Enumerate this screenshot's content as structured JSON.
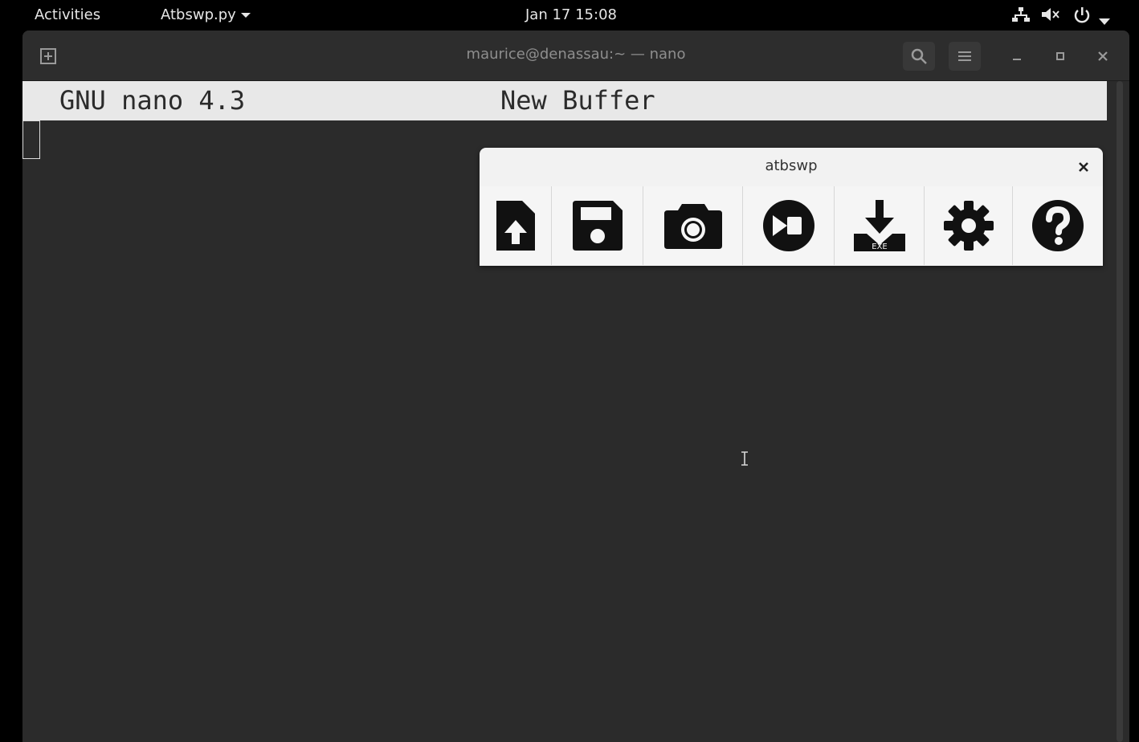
{
  "topbar": {
    "activities": "Activities",
    "app_menu": "Atbswp.py",
    "clock": "Jan 17  15:08",
    "icons": [
      "network-icon",
      "volume-muted-icon",
      "power-icon",
      "chevron-down-icon"
    ]
  },
  "terminal": {
    "title": "maurice@denassau:~ — nano",
    "header_icons": [
      "new-tab-icon",
      "search-icon",
      "hamburger-menu-icon",
      "minimize-icon",
      "maximize-icon",
      "close-icon"
    ]
  },
  "nano": {
    "version": "GNU nano 4.3",
    "buffer": "New Buffer"
  },
  "atbswp": {
    "title": "atbswp",
    "tools": [
      {
        "name": "load-file-button",
        "icon": "file-upload-icon"
      },
      {
        "name": "save-button",
        "icon": "floppy-disk-icon"
      },
      {
        "name": "record-button",
        "icon": "camera-icon"
      },
      {
        "name": "play-button",
        "icon": "play-circle-icon"
      },
      {
        "name": "compile-button",
        "icon": "download-exe-icon",
        "label": "EXE"
      },
      {
        "name": "settings-button",
        "icon": "gear-icon"
      },
      {
        "name": "help-button",
        "icon": "question-circle-icon"
      }
    ]
  }
}
